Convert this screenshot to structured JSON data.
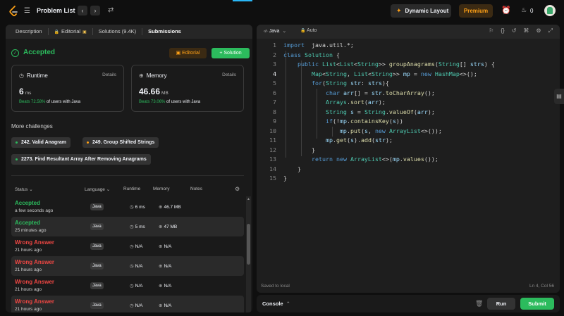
{
  "topbar": {
    "problem_list_label": "Problem List",
    "prev_icon": "‹",
    "next_icon": "›",
    "dynamic_layout_label": "Dynamic Layout",
    "premium_label": "Premium",
    "streak_count": "0"
  },
  "left_tabs": [
    {
      "label": "Description"
    },
    {
      "label": "Editorial"
    },
    {
      "label": "Solutions (9.4K)"
    },
    {
      "label": "Submissions"
    }
  ],
  "result": {
    "status": "Accepted",
    "editorial_btn": "Editorial",
    "solution_btn": "+ Solution"
  },
  "runtime_card": {
    "title": "Runtime",
    "details": "Details",
    "value": "6",
    "unit": "ms",
    "beats_pct": "Beats 72.58%",
    "beats_rest": " of users with Java"
  },
  "memory_card": {
    "title": "Memory",
    "details": "Details",
    "value": "46.66",
    "unit": "MB",
    "beats_pct": "Beats 73.06%",
    "beats_rest": " of users with Java"
  },
  "more_challenges": {
    "title": "More challenges",
    "items": [
      {
        "label": "242. Valid Anagram",
        "color": "#2cbb5d"
      },
      {
        "label": "249. Group Shifted Strings",
        "color": "#ffa116"
      },
      {
        "label": "2273. Find Resultant Array After Removing Anagrams",
        "color": "#2cbb5d"
      }
    ]
  },
  "table": {
    "headers": {
      "status": "Status",
      "language": "Language",
      "runtime": "Runtime",
      "memory": "Memory",
      "notes": "Notes"
    },
    "rows": [
      {
        "status": "Accepted",
        "time": "a few seconds ago",
        "lang": "Java",
        "runtime": "6 ms",
        "memory": "46.7 MB"
      },
      {
        "status": "Accepted",
        "time": "25 minutes ago",
        "lang": "Java",
        "runtime": "5 ms",
        "memory": "47 MB"
      },
      {
        "status": "Wrong Answer",
        "time": "21 hours ago",
        "lang": "Java",
        "runtime": "N/A",
        "memory": "N/A"
      },
      {
        "status": "Wrong Answer",
        "time": "21 hours ago",
        "lang": "Java",
        "runtime": "N/A",
        "memory": "N/A"
      },
      {
        "status": "Wrong Answer",
        "time": "21 hours ago",
        "lang": "Java",
        "runtime": "N/A",
        "memory": "N/A"
      },
      {
        "status": "Wrong Answer",
        "time": "21 hours ago",
        "lang": "Java",
        "runtime": "N/A",
        "memory": "N/A"
      }
    ]
  },
  "editor": {
    "language": "Java",
    "mode": "Auto",
    "line_numbers": [
      "1",
      "2",
      "3",
      "4",
      "5",
      "6",
      "7",
      "8",
      "9",
      "10",
      "11",
      "12",
      "13",
      "14",
      "15"
    ],
    "saved_status": "Saved to local",
    "cursor_pos": "Ln 4, Col 56"
  },
  "console": {
    "label": "Console",
    "run_label": "Run",
    "submit_label": "Submit"
  },
  "colors": {
    "accent_green": "#2cbb5d",
    "accent_orange": "#ffa116",
    "error_red": "#ef4743"
  }
}
